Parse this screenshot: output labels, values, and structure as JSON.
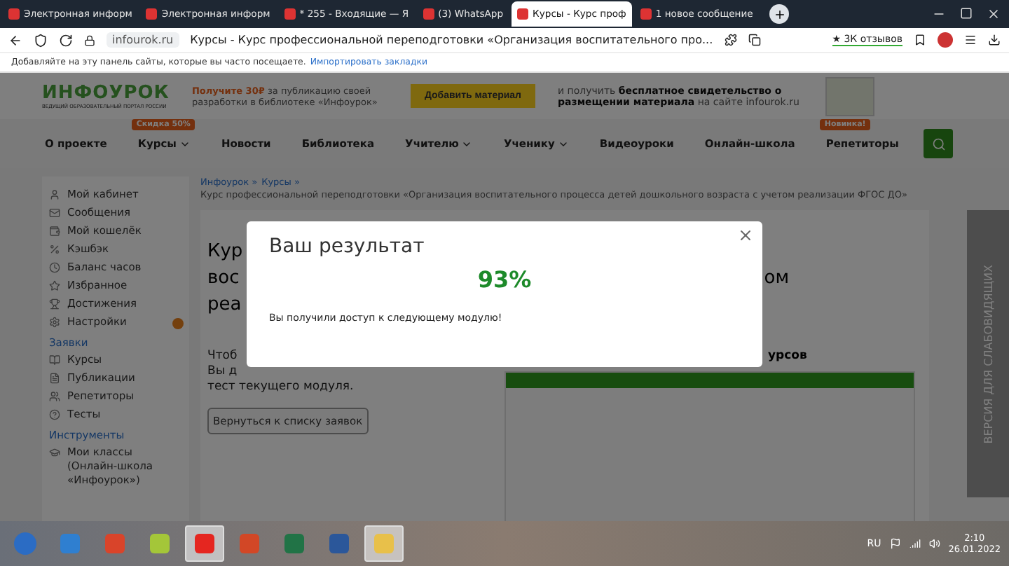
{
  "browser": {
    "tabs": [
      {
        "title": "Электронная информ",
        "selected": false
      },
      {
        "title": "Электронная информ",
        "selected": false
      },
      {
        "title": "* 255 - Входящие — Я",
        "selected": false
      },
      {
        "title": "(3) WhatsApp",
        "selected": false
      },
      {
        "title": "Курсы - Курс проф",
        "selected": true
      },
      {
        "title": "1 новое сообщение",
        "selected": false
      }
    ],
    "domain": "infourok.ru",
    "page_title": "Курсы - Курс профессиональной переподготовки «Организация воспитательного про...",
    "reviews": "★ 3К отзывов",
    "bookmarks_hint": "Добавляйте на эту панель сайты, которые вы часто посещаете.",
    "bookmarks_link": "Импортировать закладки"
  },
  "header": {
    "logo": "ИНФОУРОК",
    "tagline": "ВЕДУЩИЙ ОБРАЗОВАТЕЛЬНЫЙ ПОРТАЛ РОССИИ",
    "promo": "**Получите 30₽** за публикацию своей разработки в библиотеке «Инфоурок»",
    "add_button": "Добавить материал",
    "certificate_text": "и получить **бесплатное свидетельство о размещении материала** на сайте infourok.ru"
  },
  "nav": [
    {
      "label": "О проекте",
      "has_menu": false
    },
    {
      "label": "Курсы",
      "has_menu": true,
      "badge": "Скидка 50%"
    },
    {
      "label": "Новости",
      "has_menu": false
    },
    {
      "label": "Библиотека",
      "has_menu": false
    },
    {
      "label": "Учителю",
      "has_menu": true
    },
    {
      "label": "Ученику",
      "has_menu": true
    },
    {
      "label": "Видеоуроки",
      "has_menu": false
    },
    {
      "label": "Онлайн-школа",
      "has_menu": false
    },
    {
      "label": "Репетиторы",
      "has_menu": false,
      "badge": "Новинка!"
    }
  ],
  "sidebar": {
    "items": [
      {
        "label": "Мой кабинет",
        "alert": false
      },
      {
        "label": "Сообщения",
        "alert": false
      },
      {
        "label": "Мой кошелёк",
        "alert": false
      },
      {
        "label": "Кэшбэк",
        "alert": false
      },
      {
        "label": "Баланс часов",
        "alert": false
      },
      {
        "label": "Избранное",
        "alert": false
      },
      {
        "label": "Достижения",
        "alert": false
      },
      {
        "label": "Настройки",
        "alert": true
      }
    ],
    "sections": [
      {
        "title": "Заявки",
        "items": [
          "Курсы",
          "Публикации",
          "Репетиторы",
          "Тесты"
        ]
      },
      {
        "title": "Инструменты",
        "items": [
          "Мои классы (Онлайн-школа «Инфоурок»)"
        ]
      }
    ]
  },
  "breadcrumb": {
    "links": [
      "Инфоурок »",
      "Курсы »"
    ],
    "title": "Курс профессиональной переподготовки «Организация воспитательного процесса детей дошкольного возраста с учетом реализации ФГОС ДО»"
  },
  "content": {
    "heading_lines": [
      [
        "Кур"
      ],
      [
        "вос",
        "ом"
      ],
      [
        "реа"
      ]
    ],
    "paragraph_lines": [
      "Чтоб",
      "Вы д",
      "тест текущего модуля."
    ],
    "side_heading": "урсов",
    "back_button": "Вернуться к списку заявок"
  },
  "accessibility_tab": "ВЕРСИЯ ДЛЯ СЛАБОВИДЯЩИХ",
  "modal": {
    "title": "Ваш результат",
    "score": "93%",
    "message": "Вы получили доступ к следующему модулю!"
  },
  "taskbar": {
    "apps": [
      {
        "selected": false
      },
      {
        "selected": false
      },
      {
        "selected": false
      },
      {
        "selected": false
      },
      {
        "selected": true
      },
      {
        "selected": false
      },
      {
        "selected": false
      },
      {
        "selected": false
      },
      {
        "selected": true
      }
    ],
    "language": "RU",
    "time": "2:10",
    "date": "26.01.2022"
  }
}
